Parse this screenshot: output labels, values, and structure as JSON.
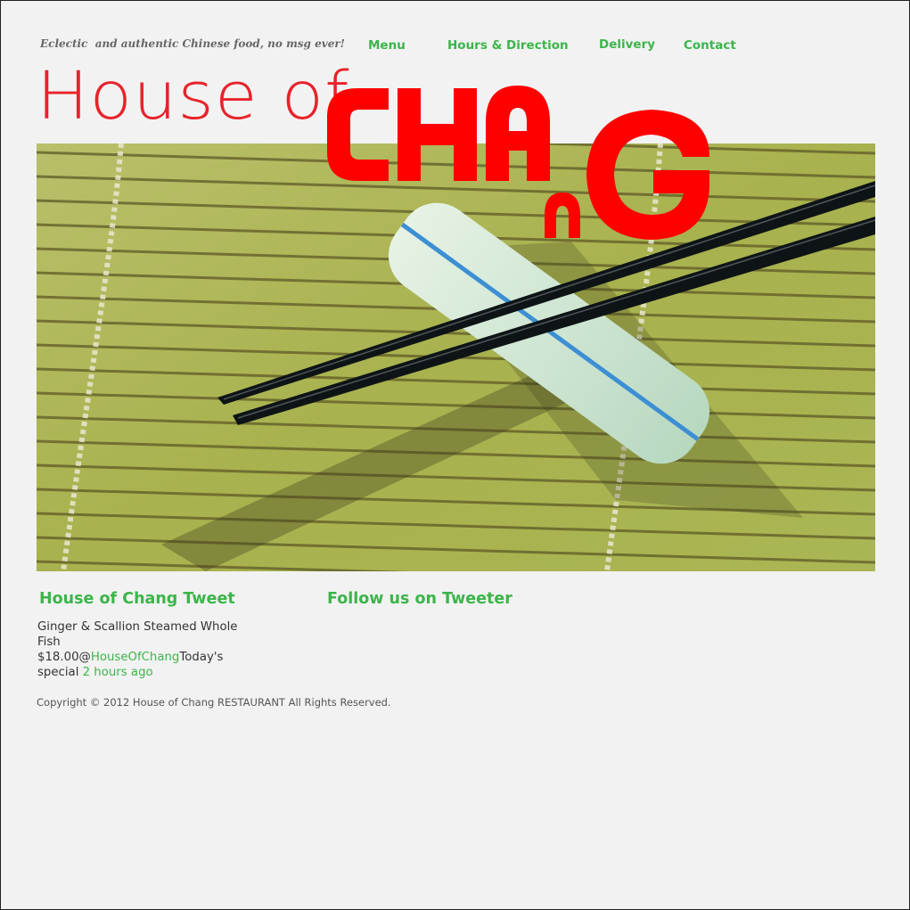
{
  "header": {
    "tagline": "Eclectic  and authentic Chinese food, no msg ever!",
    "logo_prefix": "House of",
    "logo_main": "CHAnG"
  },
  "nav": {
    "items": [
      {
        "label": "Menu"
      },
      {
        "label": "Hours & Direction"
      },
      {
        "label": "Delivery"
      },
      {
        "label": "Contact"
      }
    ]
  },
  "colors": {
    "accent_green": "#3cb54a",
    "brand_red": "#e8222a",
    "background": "#f2f2f2"
  },
  "hero": {
    "image": "chopsticks-on-bamboo-mat"
  },
  "tweets": {
    "heading": "House of Chang Tweet",
    "line1": "Ginger & Scallion Steamed Whole Fish",
    "line2_prefix": "$18.00@",
    "handle": "HouseOfChang",
    "line2_suffix": "Today's",
    "line3_prefix": "special ",
    "time_ago": "2 hours ago"
  },
  "follow": {
    "heading": "Follow us on Tweeter"
  },
  "footer": {
    "copyright": "Copyright © 2012 House of Chang RESTAURANT All Rights Reserved."
  }
}
